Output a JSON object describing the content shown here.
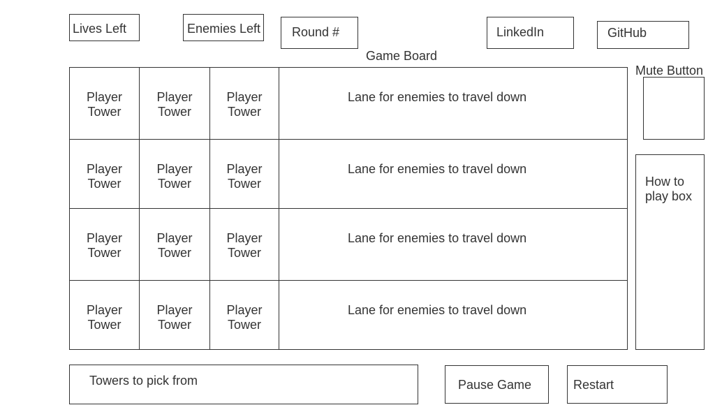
{
  "header": {
    "lives_left": "Lives Left",
    "enemies_left": "Enemies Left",
    "round": "Round #",
    "linkedin": "LinkedIn",
    "github": "GitHub"
  },
  "board": {
    "title": "Game Board",
    "rows": [
      {
        "towers": [
          "Player Tower",
          "Player Tower",
          "Player Tower"
        ],
        "lane": "Lane for enemies to travel down"
      },
      {
        "towers": [
          "Player Tower",
          "Player Tower",
          "Player Tower"
        ],
        "lane": "Lane for enemies to travel down"
      },
      {
        "towers": [
          "Player Tower",
          "Player Tower",
          "Player Tower"
        ],
        "lane": "Lane for enemies to travel down"
      },
      {
        "towers": [
          "Player Tower",
          "Player Tower",
          "Player Tower"
        ],
        "lane": "Lane for enemies to travel down"
      }
    ]
  },
  "side": {
    "mute_label": "Mute Button",
    "how_to_play": "How to play box"
  },
  "footer": {
    "towers_picker": "Towers to pick from",
    "pause": "Pause Game",
    "restart": "Restart"
  }
}
